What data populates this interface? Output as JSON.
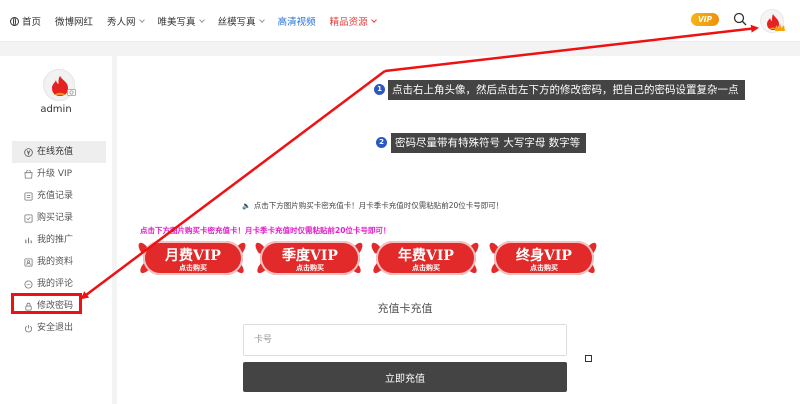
{
  "nav": {
    "items": [
      {
        "label": "首页",
        "style": "home"
      },
      {
        "label": "微博网红",
        "style": "plain"
      },
      {
        "label": "秀人网",
        "style": "dropdown"
      },
      {
        "label": "唯美写真",
        "style": "dropdown"
      },
      {
        "label": "丝模写真",
        "style": "dropdown"
      },
      {
        "label": "高清视频",
        "style": "blue"
      },
      {
        "label": "精品资源",
        "style": "red-dropdown"
      }
    ],
    "vip_badge": "VIP"
  },
  "sidebar": {
    "username": "admin",
    "menu": [
      {
        "label": "在线充值",
        "icon": "yen-icon",
        "active": true
      },
      {
        "label": "升级 VIP",
        "icon": "shop-icon",
        "active": false
      },
      {
        "label": "充值记录",
        "icon": "list-icon",
        "active": false
      },
      {
        "label": "购买记录",
        "icon": "cart-icon",
        "active": false
      },
      {
        "label": "我的推广",
        "icon": "share-icon",
        "active": false
      },
      {
        "label": "我的资料",
        "icon": "user-icon",
        "active": false
      },
      {
        "label": "我的评论",
        "icon": "comment-icon",
        "active": false
      },
      {
        "label": "修改密码",
        "icon": "lock-icon",
        "active": false
      },
      {
        "label": "安全退出",
        "icon": "power-icon",
        "active": false
      }
    ]
  },
  "annotations": {
    "step1_num": "1",
    "step1_text": "点击右上角头像，然后点击左下方的修改密码，把自己的密码设置复杂一点",
    "step2_num": "2",
    "step2_text": "密码尽量带有特殊符号 大写字母 数字等"
  },
  "main": {
    "notice": "点击下方图片购买卡密充值卡！月卡季卡充值时仅需粘贴前20位卡号即可！",
    "promo": "点击下方图片购买卡密充值卡！月卡季卡充值时仅需粘贴前20位卡号即可！",
    "vip_cards": [
      {
        "title": "月费VIP",
        "sub": "点击购买"
      },
      {
        "title": "季度VIP",
        "sub": "点击购买"
      },
      {
        "title": "年费VIP",
        "sub": "点击购买"
      },
      {
        "title": "终身VIP",
        "sub": "点击购买"
      }
    ],
    "recharge_title": "充值卡充值",
    "card_placeholder": "卡号",
    "submit_label": "立即充值"
  },
  "colors": {
    "accent_red": "#e11111",
    "vip_red": "#e22a2a",
    "tip_bg": "#444444",
    "step_badge": "#2c57c2",
    "promo_pink": "#e020c8"
  }
}
